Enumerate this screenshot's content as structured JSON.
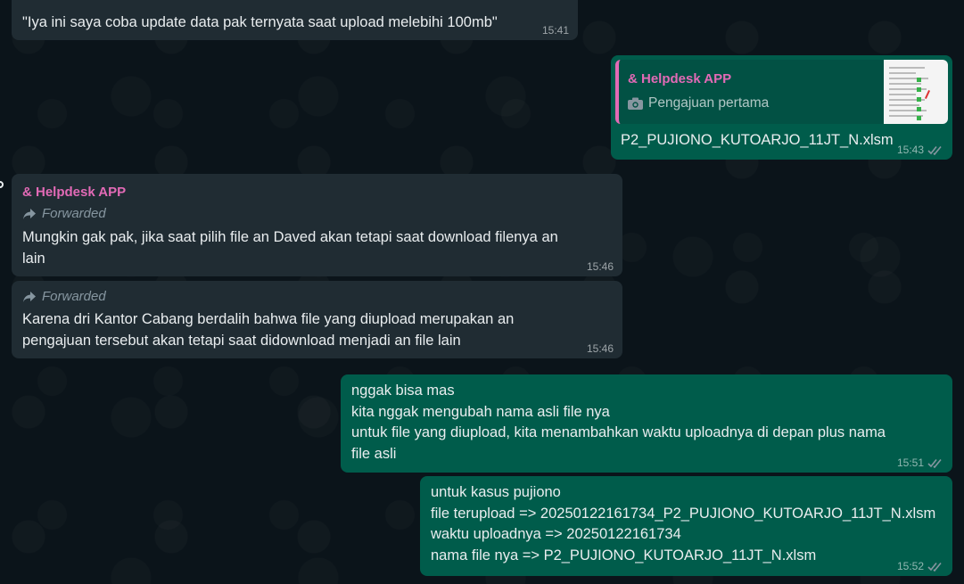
{
  "messages": [
    {
      "text": "\"Iya ini saya coba update data pak ternyata saat upload melebihi 100mb\"",
      "time": "15:41"
    },
    {
      "quote_sender": "& Helpdesk APP",
      "quote_text": "Pengajuan pertama",
      "text": "P2_PUJIONO_KUTOARJO_11JT_N.xlsm",
      "time": "15:43"
    },
    {
      "sender": "& Helpdesk APP",
      "forwarded": "Forwarded",
      "text": "Mungkin gak pak, jika saat pilih file an Daved akan tetapi saat download filenya an\nlain",
      "time": "15:46"
    },
    {
      "forwarded": "Forwarded",
      "text": "Karena dri Kantor Cabang berdalih bahwa file yang diupload merupakan an\npengajuan tersebut akan tetapi saat didownload menjadi an file lain",
      "time": "15:46"
    },
    {
      "text": "nggak bisa mas\nkita nggak mengubah nama asli file nya\nuntuk file yang diupload, kita menambahkan waktu uploadnya di depan plus nama\nfile asli",
      "time": "15:51"
    },
    {
      "text": "untuk kasus pujiono\nfile terupload => 20250122161734_P2_PUJIONO_KUTOARJO_11JT_N.xlsm\nwaktu uploadnya => 20250122161734\nnama file nya => P2_PUJIONO_KUTOARJO_11JT_N.xlsm",
      "time": "15:52"
    }
  ],
  "icons": {
    "read_receipt": "double-check-icon",
    "forward": "forward-arrow-icon",
    "camera": "camera-icon"
  },
  "colors": {
    "incoming": "#202c33",
    "outgoing": "#005c4b",
    "sender": "#e26ab6",
    "background": "#0b141a"
  }
}
